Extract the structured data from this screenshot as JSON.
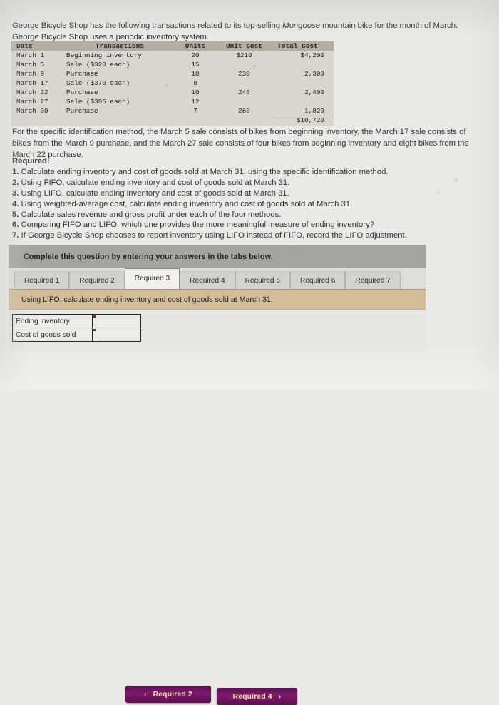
{
  "intro": {
    "part1": "George Bicycle Shop has the following transactions related to its top-selling ",
    "italic": "Mongoose",
    "part2": " mountain bike for the month of March. George Bicycle Shop uses a periodic inventory system."
  },
  "transactions_table": {
    "headers": [
      "Date",
      "Transactions",
      "Units",
      "Unit Cost",
      "Total Cost"
    ],
    "rows": [
      {
        "date": "March 1",
        "transaction": "Beginning inventory",
        "units": "20",
        "unit_cost": "$210",
        "total_cost": "$4,200"
      },
      {
        "date": "March 5",
        "transaction": "Sale ($320 each)",
        "units": "15",
        "unit_cost": "",
        "total_cost": ""
      },
      {
        "date": "March 9",
        "transaction": "Purchase",
        "units": "10",
        "unit_cost": "230",
        "total_cost": "2,300"
      },
      {
        "date": "March 17",
        "transaction": "Sale ($370 each)",
        "units": "8",
        "unit_cost": "",
        "total_cost": ""
      },
      {
        "date": "March 22",
        "transaction": "Purchase",
        "units": "10",
        "unit_cost": "240",
        "total_cost": "2,400"
      },
      {
        "date": "March 27",
        "transaction": "Sale ($395 each)",
        "units": "12",
        "unit_cost": "",
        "total_cost": ""
      },
      {
        "date": "March 30",
        "transaction": "Purchase",
        "units": "7",
        "unit_cost": "260",
        "total_cost": "1,820"
      }
    ],
    "grand_total": "$10,720"
  },
  "specific_identification_note": "For the specific identification method, the March 5 sale consists of bikes from beginning inventory, the March 17 sale consists of bikes from the March 9 purchase, and the March 27 sale consists of four bikes from beginning inventory and eight bikes from the March 22 purchase.",
  "required": {
    "title": "Required:",
    "items": [
      {
        "num": "1.",
        "text": " Calculate ending inventory and cost of goods sold at March 31, using the specific identification method."
      },
      {
        "num": "2.",
        "text": " Using FIFO, calculate ending inventory and cost of goods sold at March 31."
      },
      {
        "num": "3.",
        "text": " Using LIFO, calculate ending inventory and cost of goods sold at March 31."
      },
      {
        "num": "4.",
        "text": " Using weighted-average cost, calculate ending inventory and cost of goods sold at March 31."
      },
      {
        "num": "5.",
        "text": " Calculate sales revenue and gross profit under each of the four methods."
      },
      {
        "num": "6.",
        "text": " Comparing FIFO and LIFO, which one provides the more meaningful measure of ending inventory?"
      },
      {
        "num": "7.",
        "text": " If George Bicycle Shop chooses to report inventory using LIFO instead of FIFO, record the LIFO adjustment."
      }
    ]
  },
  "widget": {
    "banner": "Complete this question by entering your answers in the tabs below.",
    "tabs": [
      {
        "label": "Required 1",
        "active": false
      },
      {
        "label": "Required 2",
        "active": false
      },
      {
        "label": "Required 3",
        "active": true
      },
      {
        "label": "Required 4",
        "active": false
      },
      {
        "label": "Required 5",
        "active": false
      },
      {
        "label": "Required 6",
        "active": false
      },
      {
        "label": "Required 7",
        "active": false
      }
    ],
    "tan_header": "Using LIFO, calculate ending inventory and cost of goods sold at March 31.",
    "answer_rows": [
      {
        "label": "Ending inventory",
        "value": ""
      },
      {
        "label": "Cost of goods sold",
        "value": ""
      }
    ],
    "prev_button": {
      "label": "Required 2",
      "chevron": "‹"
    },
    "next_button": {
      "label": "Required 4",
      "chevron": "›"
    }
  },
  "colors": {
    "page_bg": "#e9e9e6",
    "banner_gray": "#a4a5a3",
    "tan": "#d2bd97",
    "button_purple": "#6b1360",
    "button_text": "#f4e39a",
    "table_header": "#b5ada2"
  }
}
